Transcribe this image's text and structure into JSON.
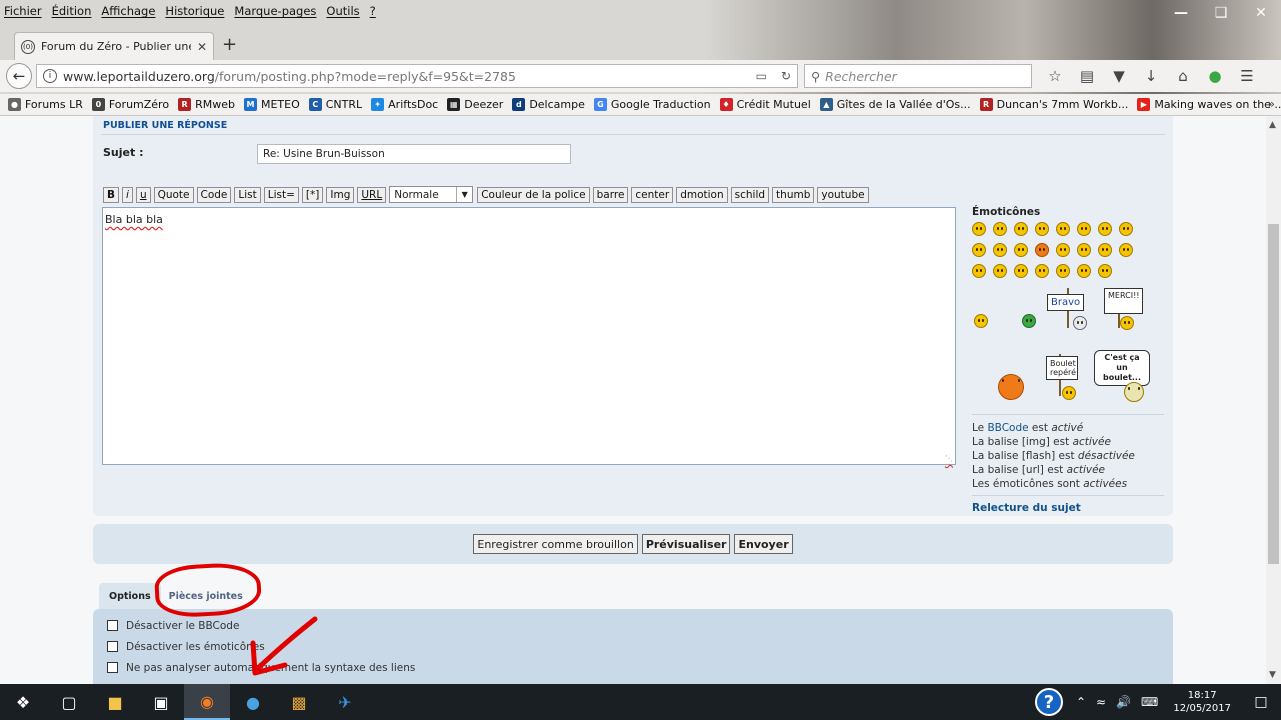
{
  "browser": {
    "menu": [
      "Fichier",
      "Édition",
      "Affichage",
      "Historique",
      "Marque-pages",
      "Outils",
      "?"
    ],
    "tab_title": "Forum du Zéro - Publier une",
    "url_host": "www.leportailduzero.org",
    "url_path": "/forum/posting.php?mode=reply&f=95&t=2785",
    "search_placeholder": "Rechercher",
    "bookmarks": [
      {
        "label": "Forums LR",
        "icon": "globe-icon",
        "color": "#666666"
      },
      {
        "label": "ForumZéro",
        "icon": "site-icon",
        "color": "#444444"
      },
      {
        "label": "RMweb",
        "icon": "rm-icon",
        "color": "#b22222"
      },
      {
        "label": "METEO",
        "icon": "weather-icon",
        "color": "#1f6fd1"
      },
      {
        "label": "CNTRL",
        "icon": "monitor-icon",
        "color": "#1f5fa8"
      },
      {
        "label": "AriftsDoc",
        "icon": "doc-icon",
        "color": "#1e88e5"
      },
      {
        "label": "Deezer",
        "icon": "deezer-icon",
        "color": "#222222"
      },
      {
        "label": "Delcampe",
        "icon": "delcampe-icon",
        "color": "#103e7a"
      },
      {
        "label": "Google Traduction",
        "icon": "translate-icon",
        "color": "#4285f4"
      },
      {
        "label": "Crédit Mutuel",
        "icon": "bank-icon",
        "color": "#d2232a"
      },
      {
        "label": "Gîtes de la Vallée d'Os...",
        "icon": "landscape-icon",
        "color": "#2d5f8a"
      },
      {
        "label": "Duncan's 7mm Workb...",
        "icon": "rm-icon",
        "color": "#b22222"
      },
      {
        "label": "Making waves on the ...",
        "icon": "youtube-icon",
        "color": "#e62117"
      }
    ]
  },
  "post": {
    "heading": "PUBLIER UNE RÉPONSE",
    "subject_label": "Sujet :",
    "subject_value": "Re: Usine Brun-Buisson",
    "bbcode_buttons": [
      "B",
      "i",
      "u",
      "Quote",
      "Code",
      "List",
      "List=",
      "[*]",
      "Img",
      "URL"
    ],
    "font_size_select": "Normale",
    "bbcode_buttons2": [
      "Couleur de la police",
      "barre",
      "center",
      "dmotion",
      "schild",
      "thumb",
      "youtube"
    ],
    "message": "Bla bla bla",
    "emoticons_title": "Émoticônes",
    "sign_bravo": "Bravo",
    "sign_merci": "MERCI!!",
    "sign_boulet": "Boulet repéré",
    "sign_cestca": "C'est ça un boulet...",
    "info": {
      "bbcode_pre": "Le ",
      "bbcode_link": "BBCode",
      "bbcode_mid": " est ",
      "bbcode_state": "activé",
      "img_pre": "La balise [img] est ",
      "img_state": "activée",
      "flash_pre": "La balise [flash] est ",
      "flash_state": "désactivée",
      "url_pre": "La balise [url] est ",
      "url_state": "activée",
      "emo_pre": "Les émoticônes sont ",
      "emo_state": "activées"
    },
    "review_topic": "Relecture du sujet",
    "save_draft": "Enregistrer comme brouillon",
    "preview": "Prévisualiser",
    "send": "Envoyer",
    "tab_options": "Options",
    "tab_attachments": "Pièces jointes",
    "options": [
      "Désactiver le BBCode",
      "Désactiver les émoticônes",
      "Ne pas analyser automatiquement la syntaxe des liens"
    ]
  },
  "taskbar": {
    "time": "18:17",
    "date": "12/05/2017"
  },
  "colors": {
    "accent_link": "#105289",
    "annotation": "#e00000"
  }
}
